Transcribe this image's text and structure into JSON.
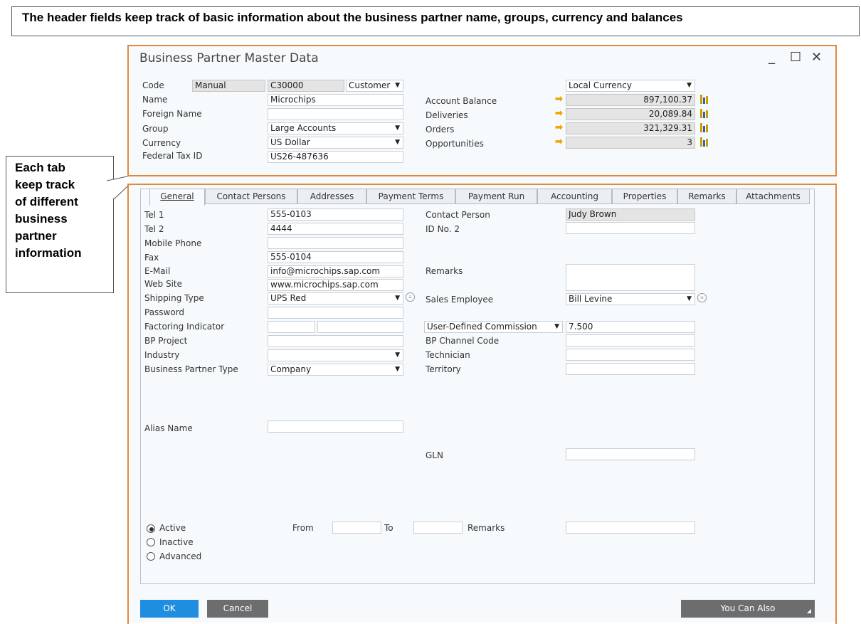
{
  "caption_top": "The header fields keep track of basic information about the business partner name, groups, currency and balances",
  "caption_side": [
    "Each tab",
    "keep track",
    "of different",
    "business",
    "partner",
    "information"
  ],
  "window": {
    "title": "Business Partner Master Data",
    "min": "_",
    "max": "☐",
    "close": "✕"
  },
  "header": {
    "code_label": "Code",
    "code_mode": "Manual",
    "code_value": "C30000",
    "type_value": "Customer",
    "name_label": "Name",
    "name_value": "Microchips",
    "foreign_name_label": "Foreign Name",
    "foreign_name_value": "",
    "group_label": "Group",
    "group_value": "Large Accounts",
    "currency_label": "Currency",
    "currency_value": "US Dollar",
    "fed_tax_label": "Federal Tax ID",
    "fed_tax_value": "US26-487636",
    "local_currency_value": "Local Currency",
    "balances": [
      {
        "label": "Account Balance",
        "value": "897,100.37"
      },
      {
        "label": "Deliveries",
        "value": "20,089.84"
      },
      {
        "label": "Orders",
        "value": "321,329.31"
      },
      {
        "label": "Opportunities",
        "value": "3"
      }
    ]
  },
  "tabs": [
    "General",
    "Contact Persons",
    "Addresses",
    "Payment Terms",
    "Payment Run",
    "Accounting",
    "Properties",
    "Remarks",
    "Attachments"
  ],
  "general": {
    "tel1_label": "Tel 1",
    "tel1_value": "555-0103",
    "tel2_label": "Tel 2",
    "tel2_value": "4444",
    "mobile_label": "Mobile Phone",
    "mobile_value": "",
    "fax_label": "Fax",
    "fax_value": "555-0104",
    "email_label": "E-Mail",
    "email_value": "info@microchips.sap.com",
    "web_label": "Web Site",
    "web_value": "www.microchips.sap.com",
    "shipping_label": "Shipping Type",
    "shipping_value": "UPS Red",
    "password_label": "Password",
    "password_value": "",
    "factoring_label": "Factoring Indicator",
    "bp_project_label": "BP Project",
    "bp_project_value": "",
    "industry_label": "Industry",
    "industry_value": "",
    "bp_type_label": "Business Partner Type",
    "bp_type_value": "Company",
    "alias_label": "Alias Name",
    "alias_value": "",
    "contact_person_label": "Contact Person",
    "contact_person_value": "Judy Brown",
    "id_no2_label": "ID No. 2",
    "id_no2_value": "",
    "remarks_label": "Remarks",
    "remarks_value": "",
    "sales_employee_label": "Sales Employee",
    "sales_employee_value": "Bill Levine",
    "commission_select": "User-Defined Commission",
    "commission_value": "7.500",
    "channel_code_label": "BP Channel Code",
    "channel_code_value": "",
    "technician_label": "Technician",
    "technician_value": "",
    "territory_label": "Territory",
    "territory_value": "",
    "gln_label": "GLN",
    "gln_value": "",
    "status_options": [
      "Active",
      "Inactive",
      "Advanced"
    ],
    "status_selected": "Active",
    "from_label": "From",
    "to_label": "To",
    "status_remarks_label": "Remarks"
  },
  "buttons": {
    "ok": "OK",
    "cancel": "Cancel",
    "you_can_also": "You Can Also"
  },
  "colors": {
    "ok_button": "#1f8ee0",
    "cancel_button": "#6d6d6d",
    "you_can_also_button": "#6d6d6d",
    "highlight_border": "#e3883a",
    "arrow": "#f0a400"
  }
}
